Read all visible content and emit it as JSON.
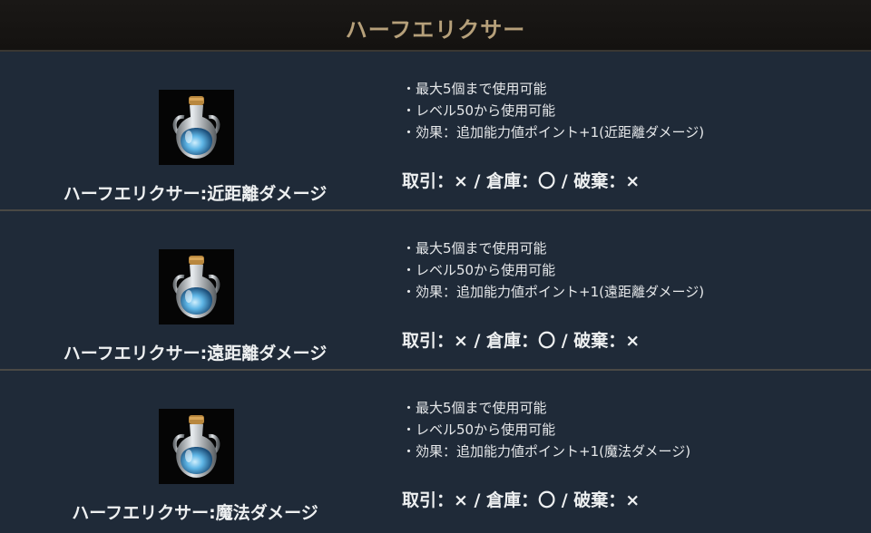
{
  "header": {
    "title": "ハーフエリクサー"
  },
  "items": [
    {
      "name": "ハーフエリクサー:近距離ダメージ",
      "icon": "potion-bottle-icon",
      "features": [
        "・最大5個まで使用可能",
        "・レベル50から使用可能",
        "・効果：追加能力値ポイント+1(近距離ダメージ)"
      ],
      "trade": "取引：× / 倉庫：〇 / 破棄：×"
    },
    {
      "name": "ハーフエリクサー:遠距離ダメージ",
      "icon": "potion-bottle-icon",
      "features": [
        "・最大5個まで使用可能",
        "・レベル50から使用可能",
        "・効果：追加能力値ポイント+1(遠距離ダメージ)"
      ],
      "trade": "取引：× / 倉庫：〇 / 破棄：×"
    },
    {
      "name": "ハーフエリクサー:魔法ダメージ",
      "icon": "potion-bottle-icon",
      "features": [
        "・最大5個まで使用可能",
        "・レベル50から使用可能",
        "・効果：追加能力値ポイント+1(魔法ダメージ)"
      ],
      "trade": "取引：× / 倉庫：〇 / 破棄：×"
    }
  ],
  "colors": {
    "background": "#1f2a38",
    "header_bg": "#161412",
    "header_text": "#b6a07a",
    "divider": "#4a4945",
    "text": "#e6e8ea"
  }
}
